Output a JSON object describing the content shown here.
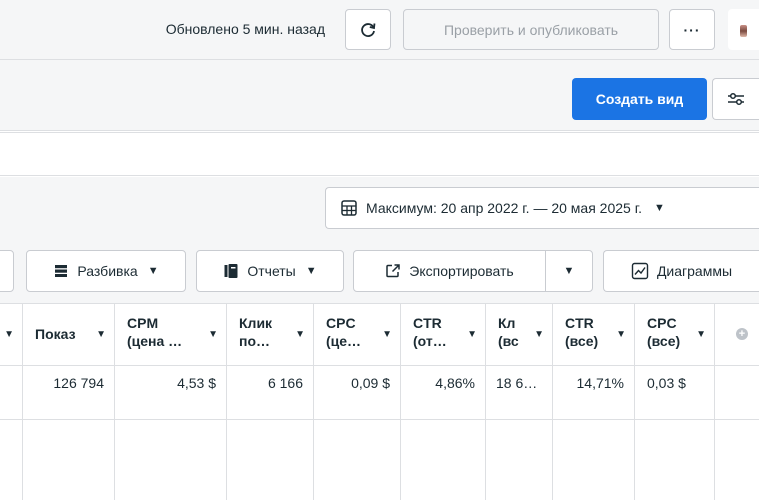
{
  "header": {
    "updated_text": "Обновлено 5 мин. назад",
    "publish_label": "Проверить и опубликовать",
    "more_label": "···"
  },
  "toolbar": {
    "create_view_label": "Создать вид"
  },
  "date_range": {
    "label": "Максимум: 20 апр 2022 г. — 20 мая 2025 г."
  },
  "actions": {
    "breakdown_label": "Разбивка",
    "reports_label": "Отчеты",
    "export_label": "Экспортировать",
    "charts_label": "Диаграммы"
  },
  "table": {
    "columns": [
      "Показ",
      "CPM\n(цена …",
      "Клик\nпо…",
      "CPC\n(це…",
      "CTR\n(от…",
      "Кл\n(вс",
      "CTR\n(все)",
      "CPC\n(все)"
    ],
    "row": [
      "126 794",
      "4,53 $",
      "6 166",
      "0,09 $",
      "4,86%",
      "18 6…",
      "14,71%",
      "0,03 $"
    ]
  }
}
